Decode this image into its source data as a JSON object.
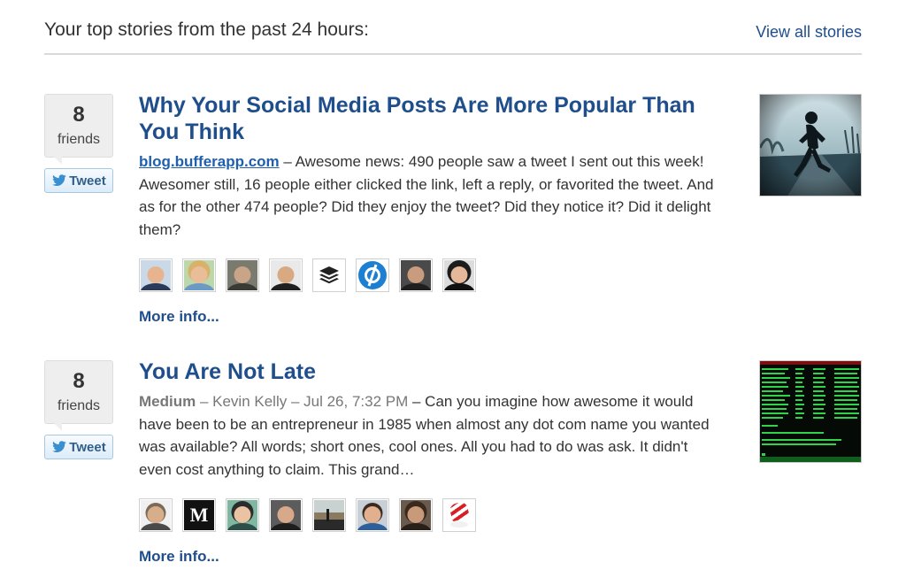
{
  "header": {
    "title": "Your top stories from the past 24 hours:",
    "view_all": "View all stories"
  },
  "stories": [
    {
      "friends_count": "8",
      "friends_label": "friends",
      "tweet_label": "Tweet",
      "title": "Why Your Social Media Posts Are More Popular Than You Think",
      "source": "blog.bufferapp.com",
      "text": " – Awesome news: 490 people saw a tweet I sent out this week! Awesomer still, 16 people either clicked the link, left a reply, or favorited the tweet. And as for the other 474 people? Did they enjoy the tweet? Did they notice it? Did it delight them?",
      "more_info": "More info...",
      "thumbnail": "runner-photo"
    },
    {
      "friends_count": "8",
      "friends_label": "friends",
      "tweet_label": "Tweet",
      "title": "You Are Not Late",
      "source": "Medium",
      "meta": " – Kevin Kelly – Jul 26, 7:32 PM",
      "text": " – Can you imagine how awesome it would have been to be an entrepreneur in 1985 when almost any dot com name you wanted was available? All words; short ones, cool ones. All you had to do was ask. It didn't even cost anything to claim. This grand…",
      "more_info": "More info...",
      "thumbnail": "terminal-screenshot",
      "medium_logo": "M"
    }
  ],
  "colors": {
    "link": "#1f4e8c",
    "source_link": "#1f5fb0",
    "meta": "#777777",
    "friends_bg": "#eeeeee",
    "tweet_bg": "#dcecf8"
  }
}
